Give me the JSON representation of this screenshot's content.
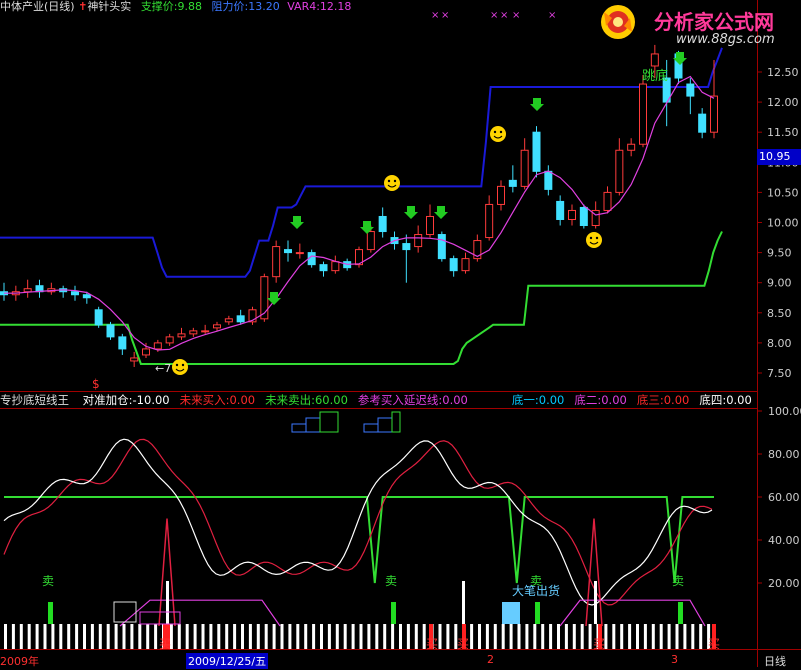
{
  "header": {
    "stock": "中体产业(日线)",
    "indicator": "神针头实",
    "support": "支撑价:9.88",
    "resistance": "阻力价:13.20",
    "var4": "VAR4:12.18",
    "price_tag": "10.95"
  },
  "logo": {
    "title": "分析家公式网",
    "url": "www.88gs.com"
  },
  "sub_header": {
    "name": "专抄底短线王",
    "items": [
      {
        "text": "对准加仓:-10.00",
        "color": "#ffffff"
      },
      {
        "text": "未来买入:0.00",
        "color": "#ff2a2a"
      },
      {
        "text": "未来卖出:60.00",
        "color": "#33dd33"
      },
      {
        "text": "参考买入延迟线:0.00",
        "color": "#e040e0"
      },
      {
        "text": "底一:0.00",
        "color": "#00c8ff"
      },
      {
        "text": "底二:0.00",
        "color": "#e040e0"
      },
      {
        "text": "底三:0.00",
        "color": "#ff2a2a"
      },
      {
        "text": "底四:0.00",
        "color": "#ffffff"
      }
    ]
  },
  "annotations": {
    "sell": "卖",
    "buy": "买",
    "big_sell": "大笔出货",
    "break_low": "跳底",
    "dollar": "$",
    "arrow_left": "←7"
  },
  "bottom_axis": {
    "year": "2009年",
    "date": "2009/12/25/五",
    "mark2": "2",
    "mark3": "3",
    "period": "日线"
  },
  "chart_data": [
    {
      "type": "candlestick",
      "title": "神针头实",
      "ylim": [
        7.3,
        13.0
      ],
      "y_ticks": [
        7.5,
        8.0,
        8.5,
        9.0,
        9.5,
        10.0,
        10.5,
        11.0,
        11.5,
        12.0,
        12.5
      ],
      "support_line": [
        9.75,
        9.75,
        9.75,
        9.75,
        9.75,
        9.75,
        9.75,
        9.75,
        9.75,
        9.75,
        9.75,
        9.75,
        9.75,
        9.75,
        9.75,
        9.75,
        9.75,
        9.75,
        9.75,
        9.75,
        9.75,
        9.75,
        9.75,
        9.75,
        9.75,
        9.75,
        9.75,
        9.75,
        9.75,
        9.75,
        9.75,
        9.75,
        9.75,
        9.75,
        9.5,
        9.25,
        9.1,
        9.1,
        9.1,
        9.1,
        9.1,
        9.1,
        9.1,
        9.1,
        9.1,
        9.1,
        9.1,
        9.1,
        9.1,
        9.1,
        9.1,
        9.1,
        9.1,
        9.1,
        9.2,
        9.45,
        9.7,
        9.7,
        9.7,
        9.95,
        10.25,
        10.25,
        10.25,
        10.25,
        10.3,
        10.45,
        10.6,
        10.6,
        10.6,
        10.6,
        10.6,
        10.6,
        10.6,
        10.6,
        10.6,
        10.6,
        10.6,
        10.6,
        10.6,
        10.6,
        10.6,
        10.6,
        10.6,
        10.6,
        10.6,
        10.6,
        10.6,
        10.6,
        10.6,
        10.6,
        10.6,
        10.6,
        10.6,
        10.6,
        10.6,
        10.6,
        10.6,
        10.6,
        10.6,
        10.6,
        10.6,
        10.6,
        10.6,
        10.6,
        10.6,
        11.35,
        12.25,
        12.25,
        12.25,
        12.25,
        12.25,
        12.25,
        12.25,
        12.25,
        12.25,
        12.25,
        12.25,
        12.25,
        12.25,
        12.25,
        12.25,
        12.25,
        12.25,
        12.25,
        12.25,
        12.25,
        12.25,
        12.25,
        12.25,
        12.25,
        12.25,
        12.25,
        12.25,
        12.25,
        12.25,
        12.25,
        12.25,
        12.25,
        12.25,
        12.25,
        12.25,
        12.25,
        12.25,
        12.25,
        12.25,
        12.25,
        12.25,
        12.25,
        12.25,
        12.25,
        12.25,
        12.25,
        12.25,
        12.25,
        12.5,
        12.7,
        12.9
      ],
      "floor_line": [
        8.3,
        8.3,
        8.3,
        8.3,
        8.3,
        8.3,
        8.3,
        8.3,
        8.3,
        8.3,
        8.3,
        8.3,
        8.3,
        8.3,
        8.3,
        8.3,
        8.3,
        8.3,
        8.3,
        8.3,
        8.3,
        8.3,
        8.3,
        8.3,
        8.3,
        8.3,
        8.3,
        8.3,
        8.3,
        8.3,
        8.05,
        7.85,
        7.65,
        7.65,
        7.65,
        7.65,
        7.65,
        7.65,
        7.65,
        7.65,
        7.65,
        7.65,
        7.65,
        7.65,
        7.65,
        7.65,
        7.65,
        7.65,
        7.65,
        7.65,
        7.65,
        7.65,
        7.65,
        7.65,
        7.65,
        7.65,
        7.65,
        7.65,
        7.65,
        7.65,
        7.65,
        7.65,
        7.65,
        7.65,
        7.65,
        7.65,
        7.65,
        7.65,
        7.65,
        7.65,
        7.65,
        7.65,
        7.65,
        7.65,
        7.65,
        7.65,
        7.65,
        7.65,
        7.65,
        7.65,
        7.65,
        7.65,
        7.65,
        7.65,
        7.65,
        7.65,
        7.65,
        7.65,
        7.65,
        7.65,
        7.65,
        7.65,
        7.65,
        7.65,
        7.65,
        7.65,
        7.65,
        7.65,
        7.65,
        7.65,
        7.65,
        7.65,
        7.65,
        7.65,
        7.7,
        7.9,
        8.0,
        8.05,
        8.1,
        8.15,
        8.2,
        8.25,
        8.3,
        8.3,
        8.3,
        8.3,
        8.3,
        8.3,
        8.3,
        8.3,
        8.95,
        8.95,
        8.95,
        8.95,
        8.95,
        8.95,
        8.95,
        8.95,
        8.95,
        8.95,
        8.95,
        8.95,
        8.95,
        8.95,
        8.95,
        8.95,
        8.95,
        8.95,
        8.95,
        8.95,
        8.95,
        8.95,
        8.95,
        8.95,
        8.95,
        8.95,
        8.95,
        8.95,
        8.95,
        8.95,
        8.95,
        8.95,
        8.95,
        8.95,
        8.95,
        8.95,
        8.95,
        8.95,
        8.95,
        8.95,
        8.95,
        9.2,
        9.5,
        9.7,
        9.85
      ],
      "candles": [
        {
          "o": 8.85,
          "c": 8.8,
          "h": 9.0,
          "l": 8.7
        },
        {
          "o": 8.8,
          "c": 8.85,
          "h": 8.95,
          "l": 8.7
        },
        {
          "o": 8.85,
          "c": 8.9,
          "h": 9.05,
          "l": 8.75
        },
        {
          "o": 8.95,
          "c": 8.85,
          "h": 9.05,
          "l": 8.75
        },
        {
          "o": 8.85,
          "c": 8.9,
          "h": 9.0,
          "l": 8.8
        },
        {
          "o": 8.9,
          "c": 8.85,
          "h": 8.95,
          "l": 8.75
        },
        {
          "o": 8.85,
          "c": 8.8,
          "h": 8.95,
          "l": 8.7
        },
        {
          "o": 8.8,
          "c": 8.75,
          "h": 8.85,
          "l": 8.65
        },
        {
          "o": 8.55,
          "c": 8.3,
          "h": 8.6,
          "l": 8.25
        },
        {
          "o": 8.3,
          "c": 8.1,
          "h": 8.35,
          "l": 8.05
        },
        {
          "o": 8.1,
          "c": 7.9,
          "h": 8.15,
          "l": 7.8
        },
        {
          "o": 7.7,
          "c": 7.75,
          "h": 7.85,
          "l": 7.6
        },
        {
          "o": 7.8,
          "c": 7.9,
          "h": 8.0,
          "l": 7.75
        },
        {
          "o": 7.9,
          "c": 8.0,
          "h": 8.05,
          "l": 7.85
        },
        {
          "o": 8.0,
          "c": 8.1,
          "h": 8.15,
          "l": 7.95
        },
        {
          "o": 8.1,
          "c": 8.15,
          "h": 8.25,
          "l": 8.05
        },
        {
          "o": 8.15,
          "c": 8.2,
          "h": 8.25,
          "l": 8.1
        },
        {
          "o": 8.2,
          "c": 8.2,
          "h": 8.3,
          "l": 8.15
        },
        {
          "o": 8.25,
          "c": 8.3,
          "h": 8.35,
          "l": 8.2
        },
        {
          "o": 8.35,
          "c": 8.4,
          "h": 8.45,
          "l": 8.3
        },
        {
          "o": 8.45,
          "c": 8.35,
          "h": 8.55,
          "l": 8.3
        },
        {
          "o": 8.35,
          "c": 8.55,
          "h": 8.6,
          "l": 8.3
        },
        {
          "o": 8.4,
          "c": 9.1,
          "h": 9.15,
          "l": 8.35
        },
        {
          "o": 9.1,
          "c": 9.6,
          "h": 9.7,
          "l": 9.0
        },
        {
          "o": 9.55,
          "c": 9.5,
          "h": 9.7,
          "l": 9.35
        },
        {
          "o": 9.5,
          "c": 9.5,
          "h": 9.65,
          "l": 9.4
        },
        {
          "o": 9.5,
          "c": 9.3,
          "h": 9.55,
          "l": 9.25
        },
        {
          "o": 9.3,
          "c": 9.2,
          "h": 9.35,
          "l": 9.1
        },
        {
          "o": 9.2,
          "c": 9.35,
          "h": 9.45,
          "l": 9.15
        },
        {
          "o": 9.35,
          "c": 9.25,
          "h": 9.4,
          "l": 9.2
        },
        {
          "o": 9.3,
          "c": 9.55,
          "h": 9.6,
          "l": 9.25
        },
        {
          "o": 9.55,
          "c": 9.85,
          "h": 9.95,
          "l": 9.5
        },
        {
          "o": 10.1,
          "c": 9.85,
          "h": 10.25,
          "l": 9.75
        },
        {
          "o": 9.75,
          "c": 9.65,
          "h": 9.85,
          "l": 9.55
        },
        {
          "o": 9.65,
          "c": 9.55,
          "h": 9.8,
          "l": 9.0
        },
        {
          "o": 9.6,
          "c": 9.8,
          "h": 9.95,
          "l": 9.5
        },
        {
          "o": 9.8,
          "c": 10.1,
          "h": 10.3,
          "l": 9.75
        },
        {
          "o": 9.8,
          "c": 9.4,
          "h": 9.85,
          "l": 9.35
        },
        {
          "o": 9.4,
          "c": 9.2,
          "h": 9.45,
          "l": 9.1
        },
        {
          "o": 9.2,
          "c": 9.4,
          "h": 9.5,
          "l": 9.15
        },
        {
          "o": 9.4,
          "c": 9.7,
          "h": 9.8,
          "l": 9.35
        },
        {
          "o": 9.75,
          "c": 10.3,
          "h": 10.45,
          "l": 9.7
        },
        {
          "o": 10.3,
          "c": 10.6,
          "h": 10.7,
          "l": 10.2
        },
        {
          "o": 10.7,
          "c": 10.6,
          "h": 10.95,
          "l": 10.5
        },
        {
          "o": 10.6,
          "c": 11.2,
          "h": 11.4,
          "l": 10.55
        },
        {
          "o": 11.5,
          "c": 10.85,
          "h": 11.6,
          "l": 10.75
        },
        {
          "o": 10.85,
          "c": 10.55,
          "h": 10.95,
          "l": 10.45
        },
        {
          "o": 10.35,
          "c": 10.05,
          "h": 10.45,
          "l": 9.95
        },
        {
          "o": 10.05,
          "c": 10.2,
          "h": 10.3,
          "l": 9.95
        },
        {
          "o": 10.25,
          "c": 9.95,
          "h": 10.3,
          "l": 9.9
        },
        {
          "o": 9.95,
          "c": 10.2,
          "h": 10.35,
          "l": 9.9
        },
        {
          "o": 10.2,
          "c": 10.5,
          "h": 10.6,
          "l": 10.15
        },
        {
          "o": 10.5,
          "c": 11.2,
          "h": 11.4,
          "l": 10.45
        },
        {
          "o": 11.2,
          "c": 11.3,
          "h": 11.4,
          "l": 11.1
        },
        {
          "o": 11.3,
          "c": 12.3,
          "h": 12.45,
          "l": 11.25
        },
        {
          "o": 12.6,
          "c": 12.8,
          "h": 12.95,
          "l": 12.4
        },
        {
          "o": 12.4,
          "c": 12.0,
          "h": 12.7,
          "l": 11.6
        },
        {
          "o": 12.8,
          "c": 12.4,
          "h": 12.85,
          "l": 12.3
        },
        {
          "o": 12.3,
          "c": 12.1,
          "h": 12.4,
          "l": 11.8
        },
        {
          "o": 11.8,
          "c": 11.5,
          "h": 11.9,
          "l": 11.4
        },
        {
          "o": 11.5,
          "c": 12.1,
          "h": 12.7,
          "l": 11.4
        }
      ]
    },
    {
      "type": "line",
      "title": "专抄底短线王",
      "ylim": [
        0,
        105
      ],
      "y_ticks": [
        20,
        40,
        60,
        80,
        100
      ],
      "series": [
        {
          "name": "未来卖出",
          "color": "#33dd33",
          "values": [
            60,
            60,
            60,
            60,
            60,
            60,
            60,
            60,
            60,
            60,
            60,
            60,
            60,
            60,
            60,
            60,
            60,
            60,
            60,
            60,
            60,
            60,
            60,
            60,
            60,
            60,
            60,
            60,
            60,
            60,
            60,
            60,
            60,
            60,
            60,
            60,
            60,
            60,
            60,
            60,
            60,
            60,
            60,
            60,
            60,
            60,
            60,
            20,
            60,
            60,
            60,
            60,
            60,
            60,
            60,
            60,
            60,
            60,
            60,
            60,
            60,
            60,
            60,
            60,
            60,
            20,
            60,
            60,
            60,
            60,
            60,
            60,
            60,
            60,
            60,
            60,
            60,
            60,
            60,
            60,
            60,
            60,
            60,
            60,
            60,
            20,
            60,
            60,
            60,
            60,
            60
          ]
        }
      ]
    }
  ]
}
